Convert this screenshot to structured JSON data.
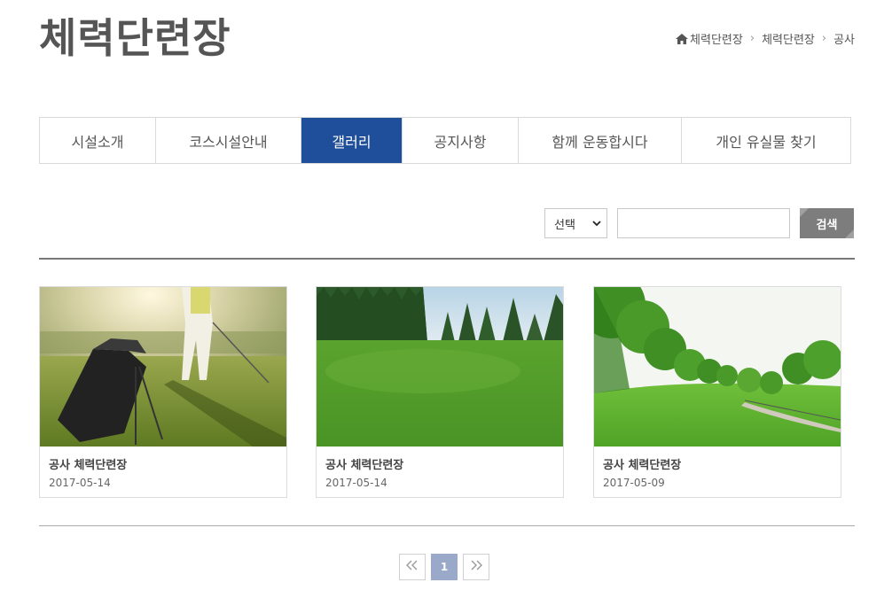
{
  "page": {
    "title": "체력단련장"
  },
  "breadcrumb": [
    "체력단련장",
    "체력단련장",
    "공사"
  ],
  "tabs": [
    {
      "label": "시설소개",
      "active": false
    },
    {
      "label": "코스시설안내",
      "active": false
    },
    {
      "label": "갤러리",
      "active": true
    },
    {
      "label": "공지사항",
      "active": false
    },
    {
      "label": "함께 운동합시다",
      "active": false
    },
    {
      "label": "개인 유실물 찾기",
      "active": false
    }
  ],
  "search": {
    "select_value": "선택",
    "input_value": "",
    "button_label": "검색"
  },
  "gallery": [
    {
      "title": "공사 체력단련장",
      "date": "2017-05-14",
      "image": "golfer-with-bag-photo"
    },
    {
      "title": "공사 체력단련장",
      "date": "2017-05-14",
      "image": "fairway-with-pines-photo"
    },
    {
      "title": "공사 체력단련장",
      "date": "2017-05-09",
      "image": "green-hill-path-photo"
    }
  ],
  "pagination": {
    "prev_icon": "double-chevron-left-icon",
    "current": "1",
    "next_icon": "double-chevron-right-icon"
  },
  "colors": {
    "accent": "#1f4e9a",
    "search_button": "#7d7d7d",
    "pager_current": "#9aa9c9"
  }
}
